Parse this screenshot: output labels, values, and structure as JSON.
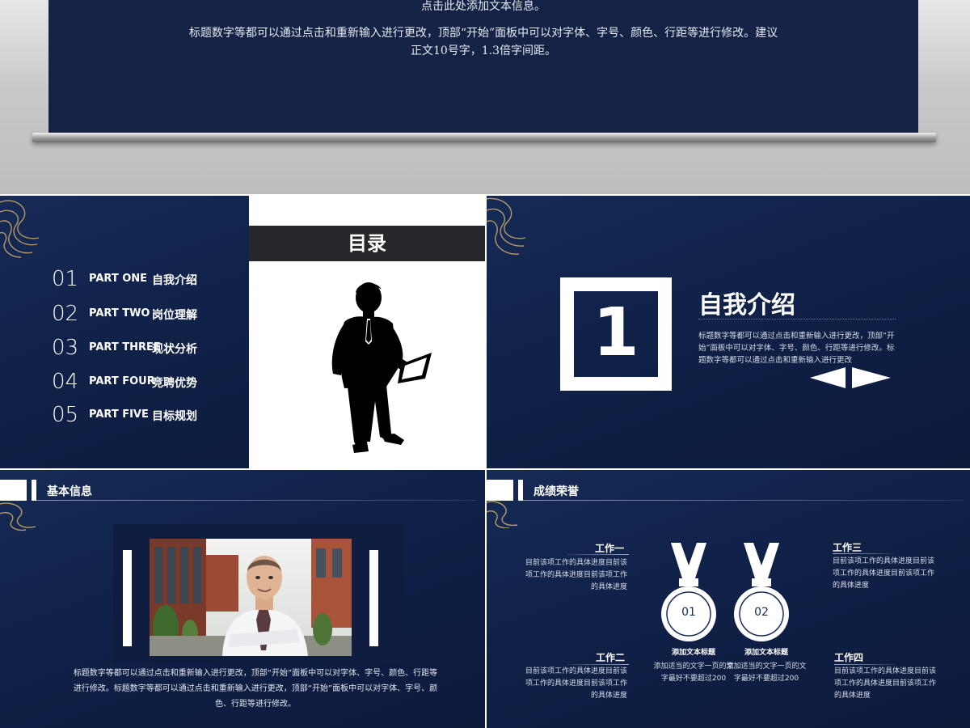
{
  "top": {
    "line1": "点击此处添加文本信息。",
    "line2": "标题数字等都可以通过点击和重新输入进行更改，顶部“开始”面板中可以对字体、字号、颜色、行距等进行修改。建议",
    "line3": "正文10号字，1.3倍字间距。"
  },
  "toc": {
    "header": "目录",
    "items": [
      {
        "num": "01",
        "part": "PART ONE",
        "title": "自我介绍"
      },
      {
        "num": "02",
        "part": "PART TWO",
        "title": "岗位理解"
      },
      {
        "num": "03",
        "part": "PART THREE",
        "title": "现状分析"
      },
      {
        "num": "04",
        "part": "PART FOUR",
        "title": "竞聘优势"
      },
      {
        "num": "05",
        "part": "PART FIVE",
        "title": "目标规划"
      }
    ]
  },
  "intro": {
    "number": "1",
    "title": "自我介绍",
    "body": "标题数字等都可以通过点击和重新输入进行更改，顶部“开始”面板中可以对字体、字号、颜色、行距等进行修改。标题数字等都可以通过点击和重新输入进行更改"
  },
  "basic": {
    "header": "基本信息",
    "body_line1": "标题数字等都可以通过点击和重新输入进行更改，顶部“开始”面板中可以对字体、字号、颜色、行距等",
    "body_line2": "进行修改。标题数字等都可以通过点击和重新输入进行更改，顶部“开始”面板中可以对字体、字号、颜",
    "body_line3": "色、行距等进行修改。"
  },
  "honors": {
    "header": "成绩荣誉",
    "works": [
      {
        "title": "工作一",
        "body": "目前该项工作的具体进度目前该项工作的具体进度目前该项工作的具体进度"
      },
      {
        "title": "工作二",
        "body": "目前该项工作的具体进度目前该项工作的具体进度目前该项工作的具体进度"
      },
      {
        "title": "工作三",
        "body": "目前该项工作的具体进度目前该项工作的具体进度目前该项工作的具体进度"
      },
      {
        "title": "工作四",
        "body": "目前该项工作的具体进度目前该项工作的具体进度目前该项工作的具体进度"
      }
    ],
    "medals": [
      {
        "num": "01",
        "caption_title": "添加文本标题",
        "caption_body": "添加适当的文字一页的文字最好不要超过200"
      },
      {
        "num": "02",
        "caption_title": "添加文本标题",
        "caption_body": "添加适当的文字一页的文字最好不要超过200"
      }
    ]
  },
  "colors": {
    "navy": "#142345",
    "white": "#ffffff",
    "dark_header": "#25272b",
    "gold": "#b89a6a"
  }
}
